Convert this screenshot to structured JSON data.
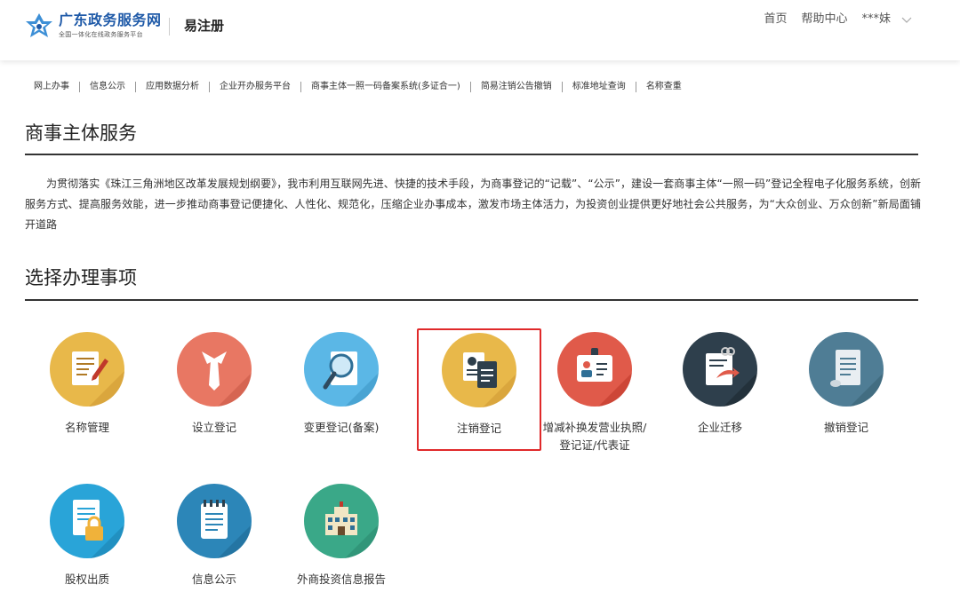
{
  "header": {
    "brand_title": "广东政务服务网",
    "brand_subtitle": "全国一体化在线政务服务平台",
    "module": "易注册",
    "nav": {
      "home": "首页",
      "help": "帮助中心",
      "user": "***妹"
    }
  },
  "subnav": [
    "网上办事",
    "信息公示",
    "应用数据分析",
    "企业开办服务平台",
    "商事主体一照一码备案系统(多证合一)",
    "简易注销公告撤销",
    "标准地址查询",
    "名称查重"
  ],
  "section1": {
    "title": "商事主体服务",
    "intro": "为贯彻落实《珠江三角洲地区改革发展规划纲要》，我市利用互联网先进、快捷的技术手段，为商事登记的“记载”、“公示”，建设一套商事主体“一照一码”登记全程电子化服务系统，创新服务方式、提高服务效能，进一步推动商事登记便捷化、人性化、规范化，压缩企业办事成本，激发市场主体活力，为投资创业提供更好地社会公共服务，为“大众创业、万众创新”新局面铺开道路"
  },
  "section2": {
    "title": "选择办理事项",
    "services": [
      {
        "label": "名称管理",
        "icon": "name-management-icon",
        "color": "#e8b84a",
        "selected": false
      },
      {
        "label": "设立登记",
        "icon": "establish-registration-icon",
        "color": "#e87763",
        "selected": false
      },
      {
        "label": "变更登记(备案)",
        "icon": "change-registration-icon",
        "color": "#5bb7e6",
        "selected": false
      },
      {
        "label": "注销登记",
        "icon": "cancel-registration-icon",
        "color": "#e8b84a",
        "selected": true
      },
      {
        "label": "增减补换发营业执照/登记证/代表证",
        "icon": "license-reissue-icon",
        "color": "#e05a4a",
        "selected": false
      },
      {
        "label": "企业迁移",
        "icon": "enterprise-migration-icon",
        "color": "#2e3f4c",
        "selected": false
      },
      {
        "label": "撤销登记",
        "icon": "revoke-registration-icon",
        "color": "#4f7d95",
        "selected": false
      },
      {
        "label": "股权出质",
        "icon": "equity-pledge-icon",
        "color": "#29a4d8",
        "selected": false
      },
      {
        "label": "信息公示",
        "icon": "info-disclosure-icon",
        "color": "#2c86b8",
        "selected": false
      },
      {
        "label": "外商投资信息报告",
        "icon": "foreign-investment-report-icon",
        "color": "#3aa888",
        "selected": false
      }
    ]
  },
  "colors": {
    "brand": "#1f5aa8",
    "selected_border": "#e0292a"
  }
}
